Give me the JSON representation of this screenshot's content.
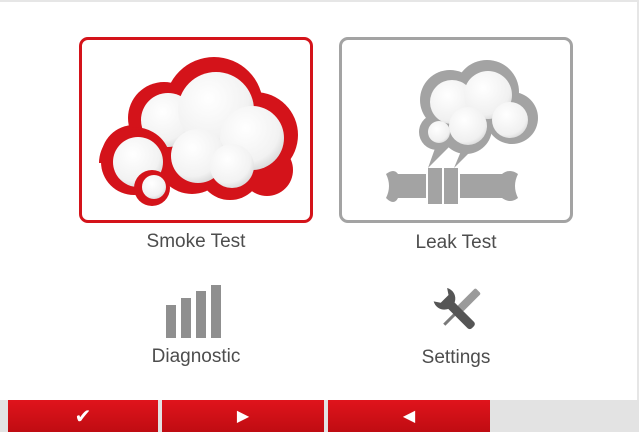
{
  "menu": {
    "smoke_test": {
      "label": "Smoke Test",
      "icon": "smoke-cloud-icon",
      "accent": "#d4131a"
    },
    "leak_test": {
      "label": "Leak Test",
      "icon": "leaking-pipe-icon",
      "accent": "#a3a3a3"
    },
    "diagnostic": {
      "label": "Diagnostic",
      "icon": "signal-bars-icon"
    },
    "settings": {
      "label": "Settings",
      "icon": "wrench-screwdriver-icon"
    }
  },
  "bottom_bar": {
    "buttons": [
      {
        "name": "confirm",
        "glyph": "✔",
        "icon": "checkmark-icon"
      },
      {
        "name": "next",
        "glyph": "▶",
        "icon": "right-arrow-icon"
      },
      {
        "name": "back",
        "glyph": "◀",
        "icon": "left-arrow-icon"
      }
    ],
    "color": "#d4131a"
  }
}
